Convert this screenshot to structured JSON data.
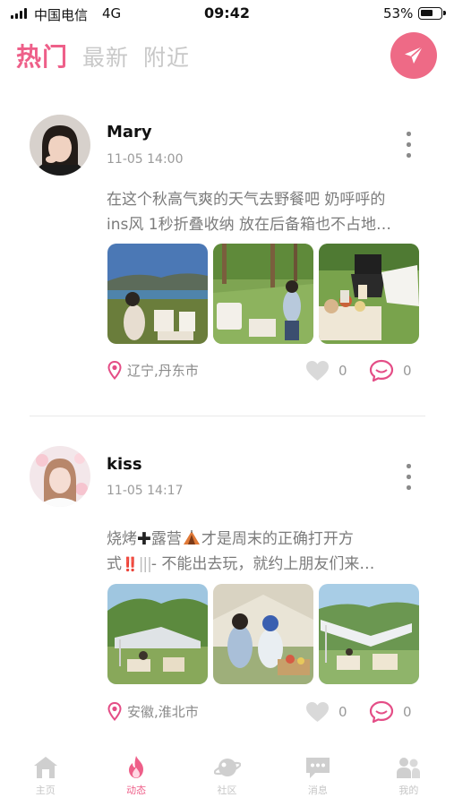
{
  "status_bar": {
    "carrier": "中国电信",
    "network": "4G",
    "time": "09:42",
    "battery": "53%",
    "battery_level": 0.53
  },
  "header": {
    "tabs": [
      {
        "label": "热门",
        "active": true
      },
      {
        "label": "最新",
        "active": false
      },
      {
        "label": "附近",
        "active": false
      }
    ],
    "send_icon": "paper-plane-icon"
  },
  "posts": [
    {
      "username": "Mary",
      "time": "11-05 14:00",
      "content_lines": [
        "在这个秋高气爽的天气去野餐吧 奶呼呼的",
        "ins风 1秒折叠收纳 放在后备箱也不占地…"
      ],
      "location": "辽宁,丹东市",
      "likes": "0",
      "comments": "0"
    },
    {
      "username": "kiss",
      "time": "11-05 14:17",
      "content_line1_prefix": "烧烤",
      "content_line1_mid": "露营",
      "content_line1_suffix": "才是周末的正确打开方",
      "content_line2_prefix": "式",
      "content_line2_suffix": "- 不能出去玩，就约上朋友们来…",
      "location": "安徽,淮北市",
      "likes": "0",
      "comments": "0"
    }
  ],
  "colors": {
    "accent": "#ee5f89",
    "send_button": "#ee6a86",
    "inactive": "#c8c8c8",
    "muted_text": "#7b7b7b"
  },
  "bottom_nav": [
    {
      "label": "主页",
      "icon": "home-icon",
      "active": false
    },
    {
      "label": "动态",
      "icon": "flame-icon",
      "active": true
    },
    {
      "label": "社区",
      "icon": "planet-icon",
      "active": false
    },
    {
      "label": "消息",
      "icon": "chat-icon",
      "active": false
    },
    {
      "label": "我的",
      "icon": "people-icon",
      "active": false
    }
  ]
}
